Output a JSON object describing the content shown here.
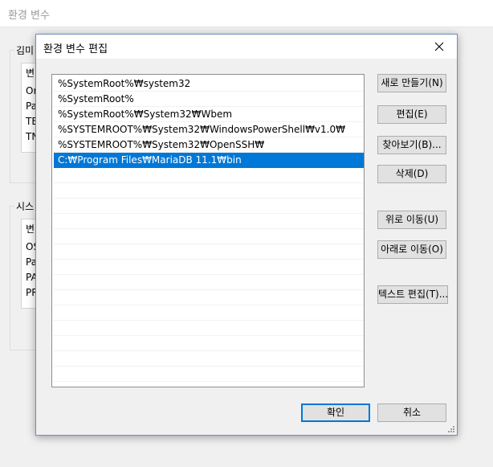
{
  "background_window": {
    "title": "환경 변수",
    "user_group_label": "김미",
    "user_rows": [
      "변",
      "Or",
      "Pa",
      "TE",
      "TN"
    ],
    "system_group_label": "시스",
    "system_rows": [
      "변",
      "OS",
      "Pa",
      "PA",
      "PR"
    ]
  },
  "dialog": {
    "title": "환경 변수 편집",
    "close_icon": "close-icon",
    "paths": [
      "%SystemRoot%₩system32",
      "%SystemRoot%",
      "%SystemRoot%₩System32₩Wbem",
      "%SYSTEMROOT%₩System32₩WindowsPowerShell₩v1.0₩",
      "%SYSTEMROOT%₩System32₩OpenSSH₩",
      "C:₩Program Files₩MariaDB 11.1₩bin"
    ],
    "selected_index": 5,
    "buttons": {
      "new": "새로 만들기(N)",
      "edit": "편집(E)",
      "browse": "찾아보기(B)...",
      "delete": "삭제(D)",
      "move_up": "위로 이동(U)",
      "move_down": "아래로 이동(O)",
      "edit_text": "텍스트 편집(T)...",
      "ok": "확인",
      "cancel": "취소"
    }
  },
  "colors": {
    "selection": "#0078d7",
    "dialog_border": "#6d8fb7",
    "button_face": "#e1e1e1"
  }
}
